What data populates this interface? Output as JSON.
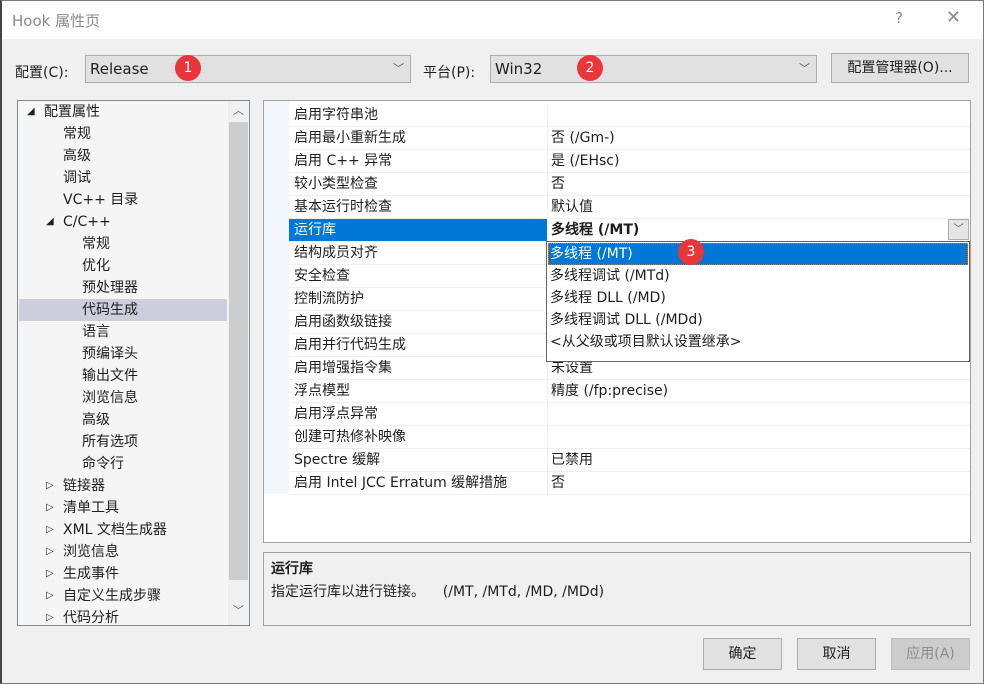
{
  "window": {
    "title": "Hook 属性页",
    "help_label": "?",
    "close_label": "✕"
  },
  "config_bar": {
    "config_label": "配置(C):",
    "config_value": "Release",
    "platform_label": "平台(P):",
    "platform_value": "Win32",
    "config_manager_label": "配置管理器(O)...",
    "chevron": "﹀"
  },
  "annotations": [
    "1",
    "2",
    "3"
  ],
  "tree": {
    "items": [
      {
        "label": "配置属性",
        "level": 0,
        "expander": "expanded"
      },
      {
        "label": "常规",
        "level": 1
      },
      {
        "label": "高级",
        "level": 1
      },
      {
        "label": "调试",
        "level": 1
      },
      {
        "label": "VC++ 目录",
        "level": 1
      },
      {
        "label": "C/C++",
        "level": 1,
        "expander": "expanded"
      },
      {
        "label": "常规",
        "level": 2
      },
      {
        "label": "优化",
        "level": 2
      },
      {
        "label": "预处理器",
        "level": 2
      },
      {
        "label": "代码生成",
        "level": 2,
        "selected": true
      },
      {
        "label": "语言",
        "level": 2
      },
      {
        "label": "预编译头",
        "level": 2
      },
      {
        "label": "输出文件",
        "level": 2
      },
      {
        "label": "浏览信息",
        "level": 2
      },
      {
        "label": "高级",
        "level": 2
      },
      {
        "label": "所有选项",
        "level": 2
      },
      {
        "label": "命令行",
        "level": 2
      },
      {
        "label": "链接器",
        "level": 1,
        "expander": "collapsed"
      },
      {
        "label": "清单工具",
        "level": 1,
        "expander": "collapsed"
      },
      {
        "label": "XML 文档生成器",
        "level": 1,
        "expander": "collapsed"
      },
      {
        "label": "浏览信息",
        "level": 1,
        "expander": "collapsed"
      },
      {
        "label": "生成事件",
        "level": 1,
        "expander": "collapsed"
      },
      {
        "label": "自定义生成步骤",
        "level": 1,
        "expander": "collapsed"
      },
      {
        "label": "代码分析",
        "level": 1,
        "expander": "collapsed"
      }
    ],
    "scroll_up": "︿",
    "scroll_down": "﹀"
  },
  "properties": {
    "rows": [
      {
        "name": "启用字符串池",
        "value": ""
      },
      {
        "name": "启用最小重新生成",
        "value": "否 (/Gm-)"
      },
      {
        "name": "启用 C++ 异常",
        "value": "是 (/EHsc)"
      },
      {
        "name": "较小类型检查",
        "value": "否"
      },
      {
        "name": "基本运行时检查",
        "value": "默认值"
      },
      {
        "name": "运行库",
        "value": "多线程 (/MT)",
        "selected": true
      },
      {
        "name": "结构成员对齐",
        "value": ""
      },
      {
        "name": "安全检查",
        "value": ""
      },
      {
        "name": "控制流防护",
        "value": ""
      },
      {
        "name": "启用函数级链接",
        "value": ""
      },
      {
        "name": "启用并行代码生成",
        "value": ""
      },
      {
        "name": "启用增强指令集",
        "value": "未设置"
      },
      {
        "name": "浮点模型",
        "value": "精度 (/fp:precise)"
      },
      {
        "name": "启用浮点异常",
        "value": ""
      },
      {
        "name": "创建可热修补映像",
        "value": ""
      },
      {
        "name": "Spectre 缓解",
        "value": "已禁用"
      },
      {
        "name": "启用 Intel JCC Erratum 缓解措施",
        "value": "否"
      }
    ],
    "dropdown_chevron": "﹀"
  },
  "runtime_dropdown": {
    "options": [
      {
        "label": "多线程 (/MT)",
        "selected": true
      },
      {
        "label": "多线程调试 (/MTd)"
      },
      {
        "label": "多线程 DLL (/MD)"
      },
      {
        "label": "多线程调试 DLL (/MDd)"
      },
      {
        "label": "<从父级或项目默认设置继承>"
      }
    ]
  },
  "description": {
    "title": "运行库",
    "text": "指定运行库以进行链接。    (/MT, /MTd, /MD, /MDd)"
  },
  "footer": {
    "ok_label": "确定",
    "cancel_label": "取消",
    "apply_label": "应用(A)"
  },
  "colors": {
    "accent": "#0078d7",
    "badge": "#e8363a",
    "tree_selected": "#cccedb"
  }
}
